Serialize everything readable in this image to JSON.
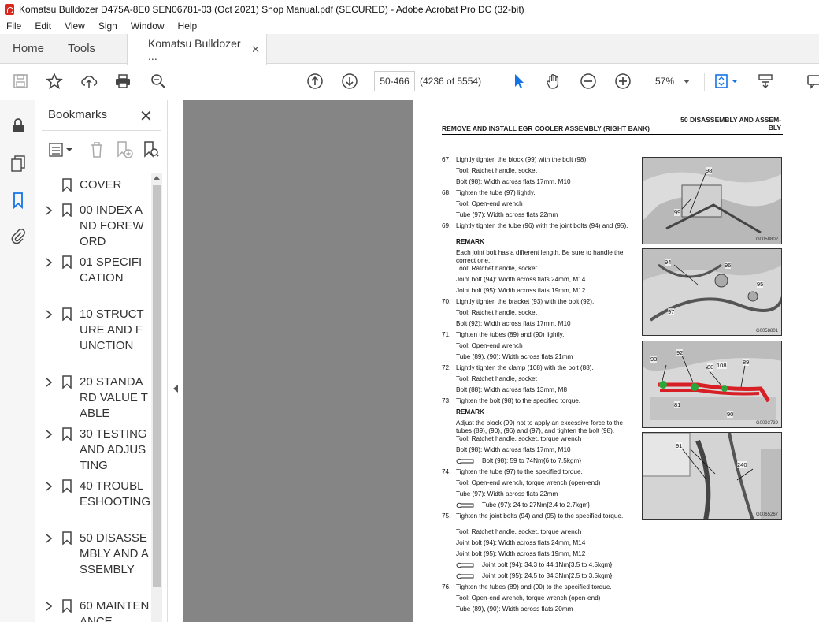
{
  "window": {
    "title": "Komatsu Bulldozer D475A-8E0 SEN06781-03 (Oct 2021) Shop Manual.pdf (SECURED) - Adobe Acrobat Pro DC (32-bit)"
  },
  "menu": [
    "File",
    "Edit",
    "View",
    "Sign",
    "Window",
    "Help"
  ],
  "tabs": {
    "home": "Home",
    "tools": "Tools",
    "doc": "Komatsu Bulldozer ...",
    "close": "✕"
  },
  "toolbar": {
    "page_input": "50-466",
    "page_count": "(4236 of 5554)",
    "zoom": "57%"
  },
  "bookmarks": {
    "title": "Bookmarks",
    "close": "✕",
    "items": [
      {
        "label": "COVER",
        "expandable": false
      },
      {
        "label": "00 INDEX AND FOREWORD",
        "expandable": true
      },
      {
        "label": "01 SPECIFICATION",
        "expandable": true
      },
      {
        "label": "10 STRUCTURE AND FUNCTION",
        "expandable": true
      },
      {
        "label": "20 STANDARD VALUE TABLE",
        "expandable": true
      },
      {
        "label": "30 TESTING AND ADJUSTING",
        "expandable": true
      },
      {
        "label": "40 TROUBLESHOOTING",
        "expandable": true
      },
      {
        "label": "50 DISASSEMBLY AND ASSEMBLY",
        "expandable": true
      },
      {
        "label": "60 MAINTENANCE",
        "expandable": true
      }
    ]
  },
  "doc": {
    "header_right": "50 DISASSEMBLY AND ASSEM-BLY",
    "header_left": "REMOVE AND INSTALL EGR COOLER ASSEMBLY (RIGHT BANK)",
    "lines": [
      {
        "n": "67.",
        "text": "Lightly tighten the block (99) with the bolt (98)."
      },
      {
        "text": "Tool: Ratchet handle, socket"
      },
      {
        "text": "Bolt (98): Width across flats 17mm, M10"
      },
      {
        "n": "68.",
        "text": "Tighten the tube (97) lightly."
      },
      {
        "text": "Tool: Open-end wrench"
      },
      {
        "text": "Tube (97): Width across flats 22mm"
      },
      {
        "n": "69.",
        "text": "Lightly tighten the tube (96) with the joint bolts (94) and (95)."
      },
      {
        "text": "REMARK",
        "bold": true
      },
      {
        "text": "Each joint bolt has a different length. Be sure to handle the correct one."
      },
      {
        "text": "Tool: Ratchet handle, socket"
      },
      {
        "text": "Joint bolt (94): Width across flats 24mm, M14"
      },
      {
        "text": "Joint bolt (95): Width across flats 19mm, M12"
      },
      {
        "n": "70.",
        "text": "Lightly tighten the bracket (93) with the bolt (92)."
      },
      {
        "text": "Tool: Ratchet handle, socket"
      },
      {
        "text": "Bolt (92): Width across flats 17mm, M10"
      },
      {
        "n": "71.",
        "text": "Tighten the tubes (89) and (90) lightly."
      },
      {
        "text": "Tool: Open-end wrench"
      },
      {
        "text": "Tube (89), (90): Width across flats 21mm"
      },
      {
        "n": "72.",
        "text": "Lightly tighten the clamp (108) with the bolt (88)."
      },
      {
        "text": "Tool: Ratchet handle, socket"
      },
      {
        "text": "Bolt (88): Width across flats 13mm, M8"
      },
      {
        "n": "73.",
        "text": "Tighten the bolt (98) to the specified torque."
      },
      {
        "text": "REMARK",
        "bold": true
      },
      {
        "text": "Adjust the block (99) not to apply an excessive force to the tubes (89), (90), (96) and (97), and tighten the bolt (98)."
      },
      {
        "text": "Tool: Ratchet handle, socket, torque wrench"
      },
      {
        "text": "Bolt (98): Width across flats 17mm, M10"
      },
      {
        "torque": true,
        "text": "Bolt (98): 59 to 74Nm{6 to 7.5kgm}"
      },
      {
        "n": "74.",
        "text": "Tighten the tube (97) to the specified torque."
      },
      {
        "text": "Tool: Open-end wrench, torque wrench (open-end)"
      },
      {
        "text": "Tube (97): Width across flats 22mm"
      },
      {
        "torque": true,
        "text": "Tube (97): 24 to 27Nm{2.4 to 2.7kgm}"
      },
      {
        "n": "75.",
        "text": "Tighten the joint bolts (94) and (95) to the specified torque."
      },
      {
        "text": "Tool: Ratchet handle, socket, torque wrench"
      },
      {
        "text": "Joint bolt (94): Width across flats 24mm, M14"
      },
      {
        "text": "Joint bolt (95): Width across flats 19mm, M12"
      },
      {
        "torque": true,
        "text": "Joint bolt (94): 34.3 to 44.1Nm{3.5 to 4.5kgm}"
      },
      {
        "torque": true,
        "text": "Joint bolt (95): 24.5 to 34.3Nm{2.5 to 3.5kgm}"
      },
      {
        "n": "76.",
        "text": "Tighten the tubes (89) and (90) to the specified torque."
      },
      {
        "text": "Tool: Open-end wrench, torque wrench (open-end)"
      },
      {
        "text": "Tube (89), (90): Width across flats 20mm"
      }
    ],
    "figures": [
      {
        "code": "G0058802",
        "callouts": [
          "98",
          "99"
        ]
      },
      {
        "code": "G0058801",
        "callouts": [
          "94",
          "96",
          "95",
          "97"
        ]
      },
      {
        "code": "G0093739",
        "callouts": [
          "93",
          "92",
          "88",
          "108",
          "89",
          "81",
          "90"
        ]
      },
      {
        "code": "G0065267",
        "callouts": [
          "91",
          "240"
        ]
      }
    ]
  }
}
